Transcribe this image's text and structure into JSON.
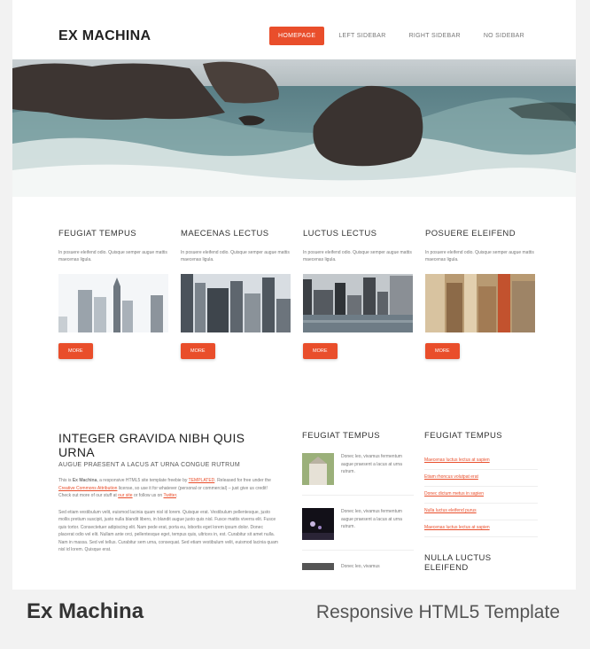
{
  "site": {
    "logo": "EX MACHINA",
    "nav": [
      "HOMEPAGE",
      "LEFT SIDEBAR",
      "RIGHT SIDEBAR",
      "NO SIDEBAR"
    ],
    "accent": "#e94e2b"
  },
  "features": [
    {
      "title": "FEUGIAT TEMPUS",
      "text": "In posuere eleifend odio. Quisque semper augue mattis maecenas ligula.",
      "button": "MORE",
      "image": "city-skyline-icon"
    },
    {
      "title": "MAECENAS LECTUS",
      "text": "In posuere eleifend odio. Quisque semper augue mattis maecenas ligula.",
      "button": "MORE",
      "image": "city-towers-icon"
    },
    {
      "title": "LUCTUS LECTUS",
      "text": "In posuere eleifend odio. Quisque semper augue mattis maecenas ligula.",
      "button": "MORE",
      "image": "city-waterfront-icon"
    },
    {
      "title": "POSUERE ELEIFEND",
      "text": "In posuere eleifend odio. Quisque semper augue mattis maecenas ligula.",
      "button": "MORE",
      "image": "city-aerial-icon"
    }
  ],
  "main": {
    "title": "INTEGER GRAVIDA NIBH QUIS URNA",
    "subtitle": "AUGUE PRAESENT A LACUS AT URNA CONGUE RUTRUM",
    "p1_a": "This is ",
    "p1_b": "Ex Machina",
    "p1_c": ", a responsive HTML5 site template freebie by ",
    "p1_link1": "TEMPLATED",
    "p1_d": ". Released for free under the ",
    "p1_link2": "Creative Commons Attribution",
    "p1_e": " license, so use it for whatever (personal or commercial) – just give us credit! Check out more of our stuff at ",
    "p1_link3": "our site",
    "p1_f": " or follow us on ",
    "p1_link4": "Twitter",
    "p1_g": ".",
    "p2": "Sed etiam vestibulum velit, euismod lacinia quam nisl id lorem. Quisque erat. Vestibulum pellentesque, justo mollis pretium suscipit, justo nulla blandit libero, in blandit augue justo quis nisl. Fusce mattis viverra elit. Fusce quis tortor. Consectetuer adipiscing elit. Nam pede erat, porta eu, lobortis eget lorem ipsum dolor. Donec placerat odio vel elit. Nullam ante orci, pellentesque eget, tempus quis, ultrices in, est. Curabitur sit amet nulla. Nam in massa. Sed vel tellus. Curabitur sem urna, consequat. Sed etiam vestibulum velit, euismod lacinia quam nisl id lorem. Quisque erat."
  },
  "mid": {
    "title": "FEUGIAT TEMPUS",
    "posts": [
      "Donec leo, vivamus fermentum augue praesent a lacus at urna rutrum.",
      "Donec leo, vivamus fermentum augue praesent a lacus at urna rutrum.",
      "Donec leo, vivamus"
    ]
  },
  "right": {
    "title": "FEUGIAT TEMPUS",
    "links": [
      "Maecenas luctus lectus at sapien",
      "Etiam rhoncus volutpat erat",
      "Donec dictum metus in sapien",
      "Nulla luctus eleifend purus",
      "Maecenas luctus lectus at sapien"
    ],
    "title2": "NULLA LUCTUS ELEIFEND"
  },
  "caption": {
    "title": "Ex Machina",
    "subtitle": "Responsive HTML5 Template"
  }
}
